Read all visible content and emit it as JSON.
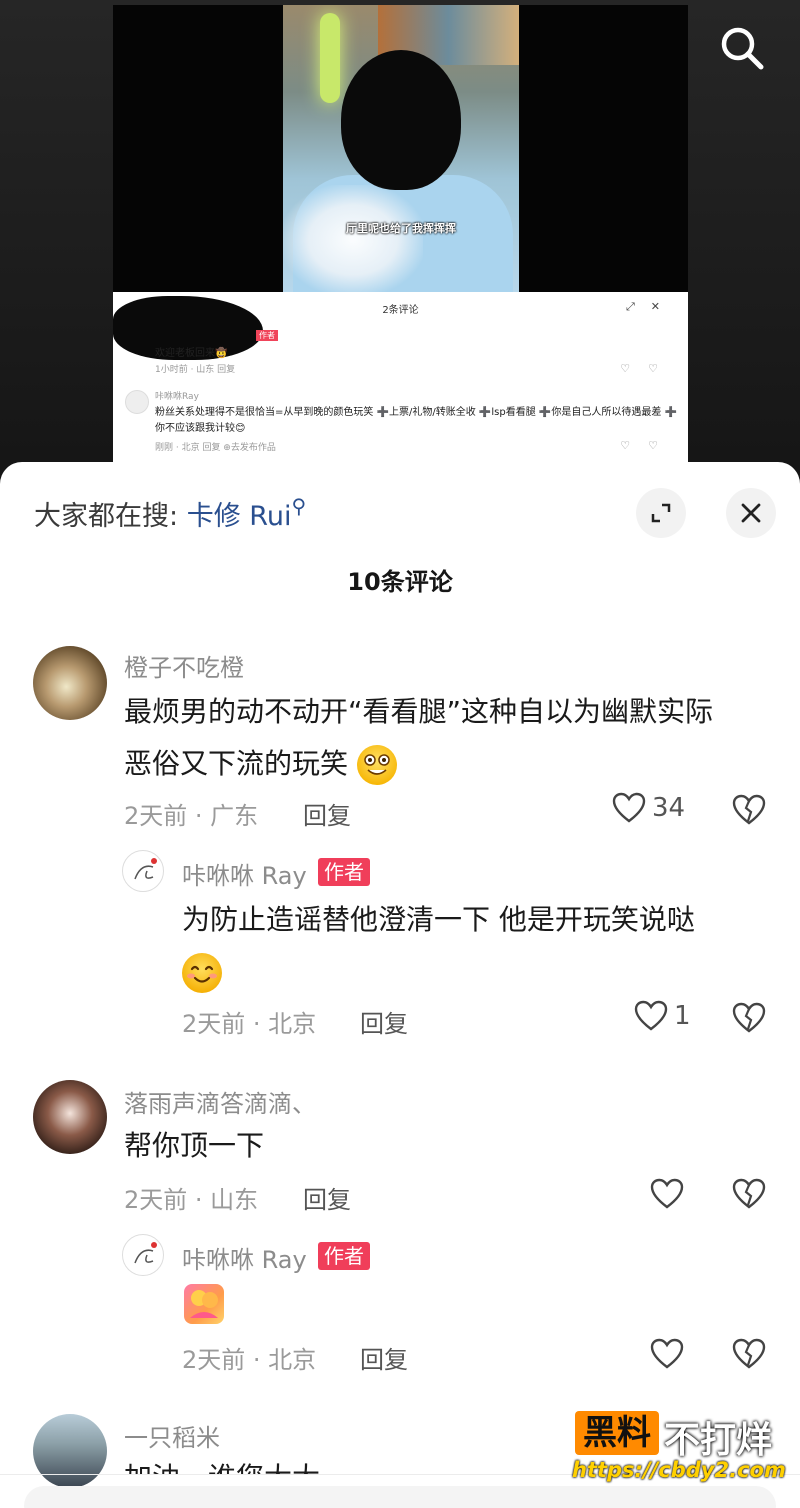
{
  "video": {
    "caption": "厅里呢也给了我挥挥挥",
    "badges": "",
    "mini_panel": {
      "title": "2条评论",
      "comment1_text": "欢迎老板回来🤠",
      "comment1_meta": "1小时前 · 山东    回复",
      "author_tag": "作者",
      "comment2_name": "咔咻咻Ray",
      "comment2_text": "粉丝关系处理得不是很恰当=从早到晚的颜色玩笑 ➕上票/礼物/转账全收 ➕lsp看看腿 ➕你是自己人所以待遇最差 ➕你不应该跟我计较😊",
      "comment2_meta": "刚刚 · 北京    回复    ⊕去发布作品"
    }
  },
  "header": {
    "hot_search_prefix": "大家都在搜:",
    "hot_search_keyword": "卡修 Rui",
    "comment_count": "10条评论"
  },
  "comments": [
    {
      "username": "橙子不吃橙",
      "text_line1": "最烦男的动不动开“看看腿”这种自以为幽默实际",
      "text_line2": "恶俗又下流的玩笑",
      "time_location": "2天前 · 广东",
      "reply_label": "回复",
      "likes": "34"
    },
    {
      "username": "咔咻咻 Ray",
      "author_tag": "作者",
      "text_line1": "为防止造谣替他澄清一下 他是开玩笑说哒",
      "time_location": "2天前 · 北京",
      "reply_label": "回复",
      "likes": "1"
    },
    {
      "username": "落雨声滴答滴滴、",
      "text_line1": "帮你顶一下",
      "time_location": "2天前 · 山东",
      "reply_label": "回复",
      "likes": ""
    },
    {
      "username": "咔咻咻 Ray",
      "author_tag": "作者",
      "time_location": "2天前 · 北京",
      "reply_label": "回复",
      "likes": ""
    },
    {
      "username": "一只稻米",
      "text_line1": "加油，谁您大大"
    }
  ],
  "watermark": {
    "box": "黑料",
    "text": "不打烊",
    "url": "https://cbdy2.com"
  },
  "colors": {
    "author_tag": "#f03e5a",
    "keyword": "#2a4f8f",
    "watermark_orange": "#ff8a00"
  }
}
